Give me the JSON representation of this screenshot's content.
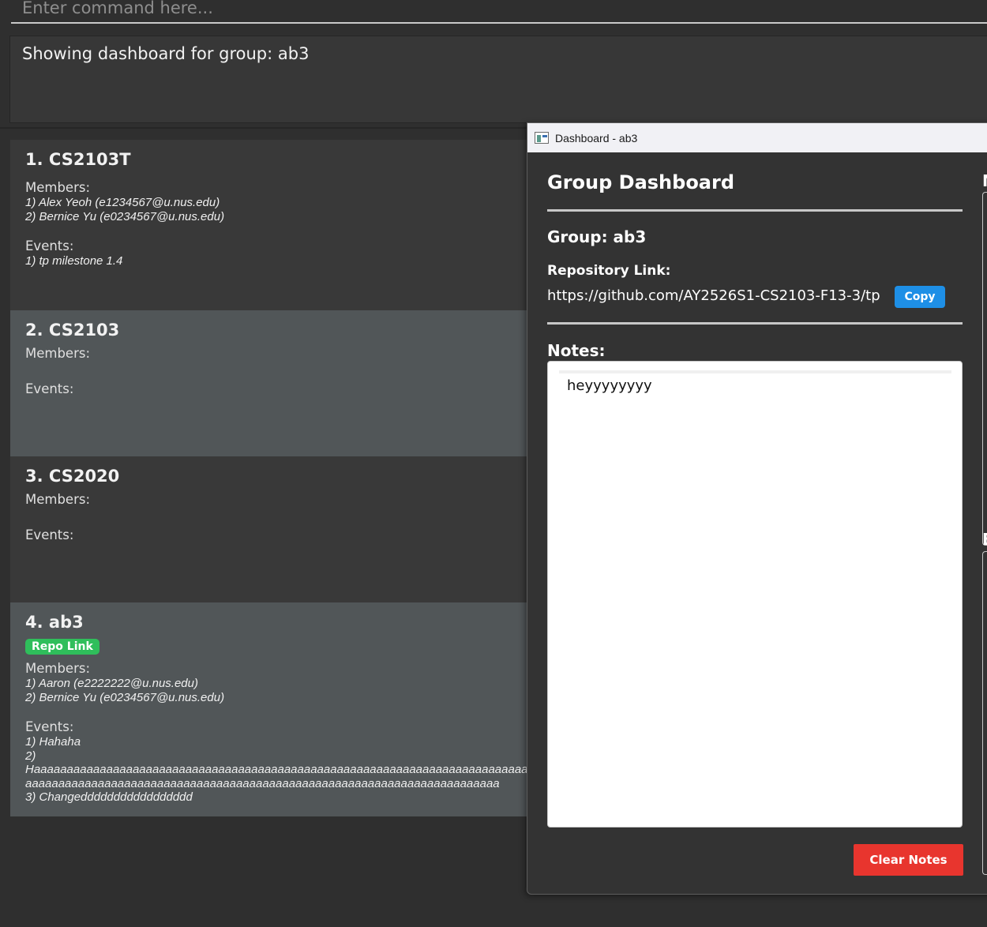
{
  "command": {
    "placeholder": "Enter command here..."
  },
  "result": {
    "text": "Showing dashboard for group: ab3"
  },
  "groups": [
    {
      "title": "1. CS2103T",
      "members_label": "Members:",
      "members": [
        "1) Alex Yeoh (e1234567@u.nus.edu)",
        "2) Bernice Yu (e0234567@u.nus.edu)"
      ],
      "events_label": "Events:",
      "events": [
        "1) tp milestone 1.4"
      ]
    },
    {
      "title": "2. CS2103",
      "members_label": "Members:",
      "members": [],
      "events_label": "Events:",
      "events": []
    },
    {
      "title": "3. CS2020",
      "members_label": "Members:",
      "members": [],
      "events_label": "Events:",
      "events": []
    },
    {
      "title": "4. ab3",
      "repo_badge": "Repo Link",
      "members_label": "Members:",
      "members": [
        "1) Aaron (e2222222@u.nus.edu)",
        "2) Bernice Yu (e0234567@u.nus.edu)"
      ],
      "events_label": "Events:",
      "events": [
        "1) Hahaha",
        "2)",
        "Haaaaaaaaaaaaaaaaaaaaaaaaaaaaaaaaaaaaaaaaaaaaaaaaaaaaaaaaaaaaaaaaaaaaaaaaaaaaaa",
        "aaaaaaaaaaaaaaaaaaaaaaaaaaaaaaaaaaaaaaaaaaaaaaaaaaaaaaaaaaaaaaaaaaaaaaaa",
        "3) Changeddddddddddddddddd"
      ]
    }
  ],
  "dashboard": {
    "window_title": "Dashboard - ab3",
    "heading": "Group Dashboard",
    "group_line": "Group: ab3",
    "repo_label": "Repository Link:",
    "repo_url": "https://github.com/AY2526S1-CS2103-F13-3/tp",
    "copy_label": "Copy",
    "notes_label": "Notes:",
    "notes_text": "heyyyyyyyy",
    "clear_label": "Clear Notes",
    "right_label_1": "M",
    "right_label_2": "E"
  },
  "colors": {
    "background": "#2f2f2f",
    "card_dark": "#393939",
    "card_light": "#515658",
    "repo_badge": "#2fbe5b",
    "copy_button": "#1e8fe6",
    "clear_button": "#e8352e"
  }
}
